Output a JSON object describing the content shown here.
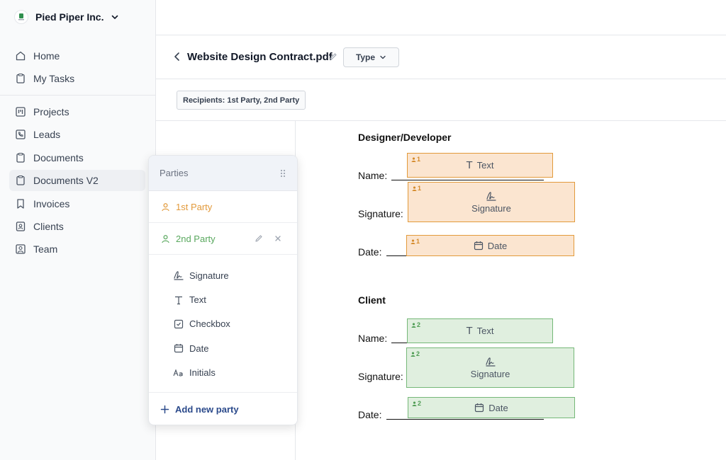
{
  "org": {
    "name": "Pied Piper Inc."
  },
  "nav": {
    "primary": [
      {
        "label": "Home",
        "icon": "home-icon"
      },
      {
        "label": "My Tasks",
        "icon": "clipboard-icon"
      }
    ],
    "secondary": [
      {
        "label": "Projects",
        "icon": "kanban-icon"
      },
      {
        "label": "Leads",
        "icon": "phone-icon"
      },
      {
        "label": "Documents",
        "icon": "clipboard-icon"
      },
      {
        "label": "Documents V2",
        "icon": "clipboard-icon",
        "active": true
      },
      {
        "label": "Invoices",
        "icon": "bookmark-icon"
      },
      {
        "label": "Clients",
        "icon": "contact-icon"
      },
      {
        "label": "Team",
        "icon": "user-square-icon"
      }
    ]
  },
  "header": {
    "title": "Website Design Contract.pdf",
    "type_label": "Type",
    "recipients": "Recipients: 1st Party, 2nd Party"
  },
  "parties_panel": {
    "title": "Parties",
    "parties": [
      {
        "label": "1st Party",
        "color": "#e29a3b"
      },
      {
        "label": "2nd Party",
        "color": "#59a85e"
      }
    ],
    "fields": [
      {
        "label": "Signature",
        "icon": "signature-icon"
      },
      {
        "label": "Text",
        "icon": "text-icon"
      },
      {
        "label": "Checkbox",
        "icon": "checkbox-icon"
      },
      {
        "label": "Date",
        "icon": "calendar-icon"
      },
      {
        "label": "Initials",
        "icon": "initials-icon"
      }
    ],
    "add_label": "Add new party"
  },
  "document": {
    "sections": [
      {
        "title": "Designer/Developer",
        "party": "1",
        "color": "#e29a3b",
        "fields": [
          {
            "label": "Name:",
            "box": "Text"
          },
          {
            "label": "Signature:",
            "box": "Signature"
          },
          {
            "label": "Date:",
            "box": "Date"
          }
        ]
      },
      {
        "title": "Client",
        "party": "2",
        "color": "#75b878",
        "fields": [
          {
            "label": "Name:",
            "box": "Text"
          },
          {
            "label": "Signature:",
            "box": "Signature"
          },
          {
            "label": "Date:",
            "box": "Date"
          }
        ]
      }
    ]
  },
  "colors": {
    "party1_fill": "#fbe5d0",
    "party2_fill": "#e0efdf",
    "link": "#2b4a8b"
  }
}
